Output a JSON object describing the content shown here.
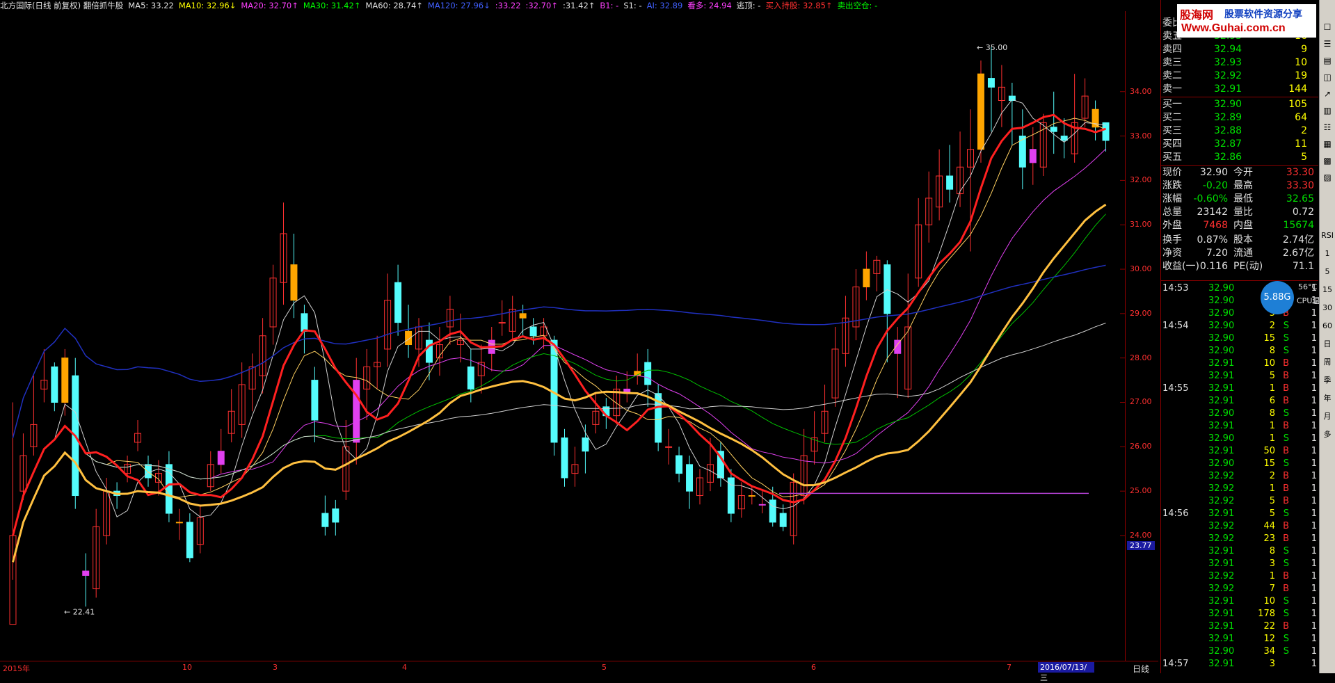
{
  "top_indicators": [
    {
      "text": "北方国际(日线 前复权) 翻倍抓牛股",
      "color": "#e0e0e0"
    },
    {
      "text": "MA5: 33.22",
      "color": "#e0e0e0"
    },
    {
      "text": "MA10: 32.96↓",
      "color": "#ffff00"
    },
    {
      "text": "MA20: 32.70↑",
      "color": "#ff40ff"
    },
    {
      "text": "MA30: 31.42↑",
      "color": "#00ff00"
    },
    {
      "text": "MA60: 28.74↑",
      "color": "#e0e0e0"
    },
    {
      "text": "MA120: 27.96↓",
      "color": "#4060ff"
    },
    {
      "text": ":33.22",
      "color": "#ff40ff"
    },
    {
      "text": ":32.70↑",
      "color": "#ff40ff"
    },
    {
      "text": ":31.42↑",
      "color": "#e0e0e0"
    },
    {
      "text": "B1: -",
      "color": "#ff40ff"
    },
    {
      "text": "S1: -",
      "color": "#e0e0e0"
    },
    {
      "text": "AI: 32.89",
      "color": "#4060ff"
    },
    {
      "text": "看多: 24.94",
      "color": "#ff40ff"
    },
    {
      "text": "逃顶: -",
      "color": "#e0e0e0"
    },
    {
      "text": "买入持股: 32.85↑",
      "color": "#ff3030"
    },
    {
      "text": "卖出空仓: -",
      "color": "#00ff00"
    }
  ],
  "price_axis": {
    "ticks": [
      "34.00",
      "33.00",
      "32.00",
      "31.00",
      "30.00",
      "29.00",
      "28.00",
      "27.00",
      "26.00",
      "25.00",
      "24.00"
    ],
    "current_label": "23.77"
  },
  "chart_labels": {
    "high": "35.00",
    "low": "22.41"
  },
  "bottom_axis": {
    "months": [
      "2015年",
      "10",
      "3",
      "4",
      "5",
      "6",
      "7"
    ],
    "date": "2016/07/13/三",
    "period": "日线"
  },
  "quote": {
    "header": "委比",
    "sells": [
      {
        "label": "卖五",
        "price": "32.95",
        "vol": "16"
      },
      {
        "label": "卖四",
        "price": "32.94",
        "vol": "9"
      },
      {
        "label": "卖三",
        "price": "32.93",
        "vol": "10"
      },
      {
        "label": "卖二",
        "price": "32.92",
        "vol": "19"
      },
      {
        "label": "卖一",
        "price": "32.91",
        "vol": "144"
      }
    ],
    "buys": [
      {
        "label": "买一",
        "price": "32.90",
        "vol": "105"
      },
      {
        "label": "买二",
        "price": "32.89",
        "vol": "64"
      },
      {
        "label": "买三",
        "price": "32.88",
        "vol": "2"
      },
      {
        "label": "买四",
        "price": "32.87",
        "vol": "11"
      },
      {
        "label": "买五",
        "price": "32.86",
        "vol": "5"
      }
    ],
    "stats": [
      {
        "l1": "现价",
        "v1": "32.90",
        "l2": "今开",
        "v2": "33.30"
      },
      {
        "l1": "涨跌",
        "v1": "-0.20",
        "l2": "最高",
        "v2": "33.30"
      },
      {
        "l1": "涨幅",
        "v1": "-0.60%",
        "l2": "最低",
        "v2": "32.65"
      },
      {
        "l1": "总量",
        "v1": "23142",
        "l2": "量比",
        "v2": "0.72"
      },
      {
        "l1": "外盘",
        "v1": "7468",
        "l2": "内盘",
        "v2": "15674"
      },
      {
        "l1": "换手",
        "v1": "0.87%",
        "l2": "股本",
        "v2": "2.74亿"
      },
      {
        "l1": "净资",
        "v1": "7.20",
        "l2": "流通",
        "v2": "2.67亿"
      },
      {
        "l1": "收益(一)",
        "v1": "0.116",
        "l2": "PE(动)",
        "v2": "71.1"
      }
    ]
  },
  "ticks": [
    {
      "time": "14:53",
      "price": "32.90",
      "vol": "",
      "bs": ""
    },
    {
      "time": "",
      "price": "32.90",
      "vol": "",
      "bs": ""
    },
    {
      "time": "",
      "price": "32.90",
      "vol": "5",
      "bs": "B"
    },
    {
      "time": "14:54",
      "price": "32.90",
      "vol": "2",
      "bs": "S"
    },
    {
      "time": "",
      "price": "32.90",
      "vol": "15",
      "bs": "S"
    },
    {
      "time": "",
      "price": "32.90",
      "vol": "8",
      "bs": "S"
    },
    {
      "time": "",
      "price": "32.91",
      "vol": "10",
      "bs": "B"
    },
    {
      "time": "",
      "price": "32.91",
      "vol": "5",
      "bs": "B"
    },
    {
      "time": "14:55",
      "price": "32.91",
      "vol": "1",
      "bs": "B"
    },
    {
      "time": "",
      "price": "32.91",
      "vol": "6",
      "bs": "B"
    },
    {
      "time": "",
      "price": "32.90",
      "vol": "8",
      "bs": "S"
    },
    {
      "time": "",
      "price": "32.91",
      "vol": "1",
      "bs": "B"
    },
    {
      "time": "",
      "price": "32.90",
      "vol": "1",
      "bs": "S"
    },
    {
      "time": "",
      "price": "32.91",
      "vol": "50",
      "bs": "B"
    },
    {
      "time": "",
      "price": "32.90",
      "vol": "15",
      "bs": "S"
    },
    {
      "time": "",
      "price": "32.92",
      "vol": "2",
      "bs": "B"
    },
    {
      "time": "",
      "price": "32.92",
      "vol": "1",
      "bs": "B"
    },
    {
      "time": "",
      "price": "32.92",
      "vol": "5",
      "bs": "B"
    },
    {
      "time": "14:56",
      "price": "32.91",
      "vol": "5",
      "bs": "S"
    },
    {
      "time": "",
      "price": "32.92",
      "vol": "44",
      "bs": "B"
    },
    {
      "time": "",
      "price": "32.92",
      "vol": "23",
      "bs": "B"
    },
    {
      "time": "",
      "price": "32.91",
      "vol": "8",
      "bs": "S"
    },
    {
      "time": "",
      "price": "32.91",
      "vol": "3",
      "bs": "S"
    },
    {
      "time": "",
      "price": "32.92",
      "vol": "1",
      "bs": "B"
    },
    {
      "time": "",
      "price": "32.92",
      "vol": "7",
      "bs": "B"
    },
    {
      "time": "",
      "price": "32.91",
      "vol": "10",
      "bs": "S"
    },
    {
      "time": "",
      "price": "32.91",
      "vol": "178",
      "bs": "S"
    },
    {
      "time": "",
      "price": "32.91",
      "vol": "22",
      "bs": "B"
    },
    {
      "time": "",
      "price": "32.91",
      "vol": "12",
      "bs": "S"
    },
    {
      "time": "",
      "price": "32.90",
      "vol": "34",
      "bs": "S"
    },
    {
      "time": "14:57",
      "price": "32.91",
      "vol": "3",
      "bs": ""
    }
  ],
  "tools": [
    "多",
    "月",
    "年",
    "季",
    "周",
    "日",
    "60",
    "30",
    "15",
    "5",
    "1",
    "RSI"
  ],
  "cpu": {
    "value": "5.88G",
    "temp": "56°C",
    "label": "CPU温度"
  },
  "watermark": {
    "line1": "股海网",
    "line1b": "股票软件资源分享",
    "line2": "Www.Guhai.com.cn"
  },
  "candles": [
    [
      22,
      24,
      27,
      23,
      24
    ],
    [
      25,
      25.8,
      26.3,
      24.8,
      26
    ],
    [
      26,
      26.5,
      27.6,
      25.8,
      27.2
    ],
    [
      27.3,
      27.5,
      28.2,
      27,
      27.9
    ],
    [
      27.8,
      27,
      27.9,
      26.8,
      27.0
    ],
    [
      27,
      28,
      28.2,
      26.7,
      27.6
    ],
    [
      27.6,
      24.9,
      28,
      24.6,
      25.1
    ],
    [
      23.2,
      23.1,
      23.6,
      22.4,
      22.6
    ],
    [
      22.8,
      24.2,
      24.6,
      22.6,
      24.3
    ],
    [
      24,
      25,
      25.3,
      23.8,
      24.9
    ],
    [
      25,
      24.9,
      25.2,
      24.6,
      25
    ],
    [
      25.4,
      25.6,
      25.8,
      25.2,
      25.5
    ],
    [
      26.1,
      26.3,
      26.6,
      25.9,
      26.2
    ],
    [
      25.6,
      25.3,
      25.8,
      25.1,
      25.5
    ],
    [
      25.2,
      25.4,
      25.7,
      24.9,
      25.3
    ],
    [
      25.6,
      24.5,
      25.9,
      24.3,
      24.4
    ],
    [
      24.3,
      24.3,
      24.6,
      23.9,
      24.2
    ],
    [
      24.3,
      23.5,
      24.5,
      23.4,
      23.6
    ],
    [
      23.8,
      24.4,
      24.7,
      23.6,
      24.3
    ],
    [
      25.1,
      25.6,
      25.9,
      25,
      25.5
    ],
    [
      25.6,
      25.9,
      26.4,
      25.4,
      26.2
    ],
    [
      26.3,
      26.8,
      27.3,
      26.1,
      26.6
    ],
    [
      26.5,
      27.4,
      27.9,
      26.2,
      27.2
    ],
    [
      27.3,
      27.8,
      28.1,
      26.8,
      27.6
    ],
    [
      27.6,
      28.5,
      28.9,
      27.2,
      28.4
    ],
    [
      28.7,
      29.8,
      30.1,
      28.3,
      29.9
    ],
    [
      29.7,
      30.8,
      31.5,
      29.2,
      30.4
    ],
    [
      30.1,
      29.3,
      30.8,
      28.9,
      29.1
    ],
    [
      29,
      28.6,
      29.2,
      28.1,
      28.3
    ],
    [
      27.5,
      26.6,
      27.8,
      26.1,
      26.5
    ],
    [
      24.5,
      24.2,
      24.9,
      24,
      24.3
    ],
    [
      24.6,
      24.3,
      24.8,
      24,
      24.5
    ],
    [
      25,
      26,
      26.6,
      24.8,
      25.7
    ],
    [
      26.1,
      27.5,
      28,
      25.6,
      27.5
    ],
    [
      27.3,
      27.8,
      28.2,
      26.6,
      27.5
    ],
    [
      27.8,
      27.9,
      28.5,
      27.3,
      28.1
    ],
    [
      28.2,
      29.3,
      29.9,
      27.8,
      29
    ],
    [
      29.7,
      28.8,
      30.1,
      28.5,
      29.4
    ],
    [
      28.6,
      28.3,
      29.2,
      28,
      28.1
    ],
    [
      28.2,
      28.7,
      28.9,
      27.8,
      28.4
    ],
    [
      28.4,
      27.9,
      28.8,
      27.5,
      28
    ],
    [
      28,
      28.3,
      28.7,
      27.6,
      28.1
    ],
    [
      28.7,
      29.1,
      29.4,
      28.3,
      28.9
    ],
    [
      28.3,
      28.4,
      29,
      27.9,
      28.1
    ],
    [
      27.8,
      27.3,
      28.2,
      27,
      27.6
    ],
    [
      27.6,
      27.9,
      28.3,
      27.2,
      27.8
    ],
    [
      28.1,
      28.4,
      28.7,
      27.7,
      28.2
    ],
    [
      28.8,
      28.8,
      29.3,
      28.5,
      28.6
    ],
    [
      28.6,
      29.1,
      29.4,
      28.4,
      28.9
    ],
    [
      29,
      28.9,
      29.2,
      28.5,
      28.7
    ],
    [
      28.7,
      28.5,
      28.9,
      28.3,
      28.4
    ],
    [
      28.5,
      28.7,
      28.9,
      28.2,
      28.6
    ],
    [
      28.4,
      26.1,
      28.5,
      25.8,
      26.2
    ],
    [
      26.2,
      25.3,
      26.4,
      25.1,
      25.3
    ],
    [
      25.4,
      25.6,
      26,
      25.1,
      25.8
    ],
    [
      26.2,
      25.9,
      26.5,
      25.4,
      26.1
    ],
    [
      26.5,
      26.8,
      27.2,
      26.3,
      26.7
    ],
    [
      26.9,
      26.7,
      27.1,
      26.4,
      26.6
    ],
    [
      26.7,
      27.3,
      27.6,
      26.5,
      27.1
    ],
    [
      27.2,
      27.3,
      27.7,
      27,
      27.4
    ],
    [
      27.6,
      27.7,
      28.1,
      27.4,
      27.9
    ],
    [
      27.9,
      27.4,
      28.2,
      26.9,
      27.2
    ],
    [
      27.2,
      26.1,
      27.4,
      25.9,
      26.1
    ],
    [
      26,
      26,
      26.4,
      25.6,
      25.7
    ],
    [
      25.8,
      25.4,
      26,
      25.2,
      25.6
    ],
    [
      25.6,
      25,
      25.8,
      24.6,
      24.8
    ],
    [
      24.9,
      25.3,
      25.5,
      24.7,
      25.1
    ],
    [
      25.2,
      25.6,
      26.2,
      25,
      26
    ],
    [
      25.9,
      25.3,
      26.1,
      25.1,
      25.4
    ],
    [
      25.3,
      24.5,
      25.5,
      24.3,
      24.5
    ],
    [
      24.6,
      24.9,
      25.2,
      24.4,
      24.9
    ],
    [
      24.9,
      24.9,
      25.1,
      24.7,
      24.9
    ],
    [
      24.7,
      24.7,
      25,
      24.5,
      24.8
    ],
    [
      24.8,
      24.3,
      25.1,
      24.2,
      24.4
    ],
    [
      24.5,
      24.2,
      24.7,
      24.1,
      24.3
    ],
    [
      24,
      25.2,
      25.4,
      23.8,
      24.6
    ],
    [
      24.9,
      25.8,
      26.4,
      24.7,
      25.7
    ],
    [
      25.9,
      26.2,
      26.8,
      25.6,
      26.3
    ],
    [
      26.3,
      26.8,
      27.4,
      26.1,
      27
    ],
    [
      27.1,
      28.2,
      28.7,
      26.9,
      28.1
    ],
    [
      28.1,
      28.9,
      29.4,
      27.8,
      28.8
    ],
    [
      28.7,
      29.6,
      30,
      28.4,
      29.7
    ],
    [
      29.6,
      30,
      30.4,
      29.3,
      29.9
    ],
    [
      29.9,
      30.2,
      30.3,
      29.5,
      30.1
    ],
    [
      30.1,
      29,
      30.2,
      27.9,
      28.2
    ],
    [
      28.1,
      28.4,
      28.7,
      27.1,
      27.3
    ],
    [
      27.3,
      28.7,
      29.9,
      27.1,
      29.8
    ],
    [
      29.8,
      31,
      31.6,
      29.6,
      30.8
    ],
    [
      31,
      31.6,
      32.2,
      30.6,
      31.3
    ],
    [
      31.4,
      32.1,
      32.7,
      31.1,
      32
    ],
    [
      32.1,
      31.8,
      32.8,
      31.5,
      31.7
    ],
    [
      31.7,
      32.3,
      33.1,
      31.4,
      32.2
    ],
    [
      32.3,
      32.7,
      33.6,
      30.4,
      32.6
    ],
    [
      32.7,
      34.4,
      34.7,
      32.4,
      34.3
    ],
    [
      34.3,
      34.1,
      35,
      33.1,
      33.8
    ],
    [
      33.8,
      34.1,
      34.6,
      33.2,
      33.9
    ],
    [
      33.9,
      33.8,
      34.2,
      32.8,
      33
    ],
    [
      33,
      32.3,
      33.6,
      31.8,
      32.4
    ],
    [
      32.4,
      32.7,
      33.2,
      31.9,
      32.3
    ],
    [
      32.3,
      33.3,
      33.5,
      32.1,
      33.2
    ],
    [
      33.2,
      33.1,
      34,
      32.6,
      33
    ],
    [
      33,
      32.9,
      33.4,
      32.5,
      32.6
    ],
    [
      32.6,
      33.3,
      34.4,
      32.4,
      33.4
    ],
    [
      33.4,
      33.9,
      34.3,
      33.2,
      33.6
    ],
    [
      33.6,
      33.2,
      33.8,
      32.9,
      33.1
    ],
    [
      33.3,
      32.9,
      33.3,
      32.65,
      32.9
    ]
  ]
}
